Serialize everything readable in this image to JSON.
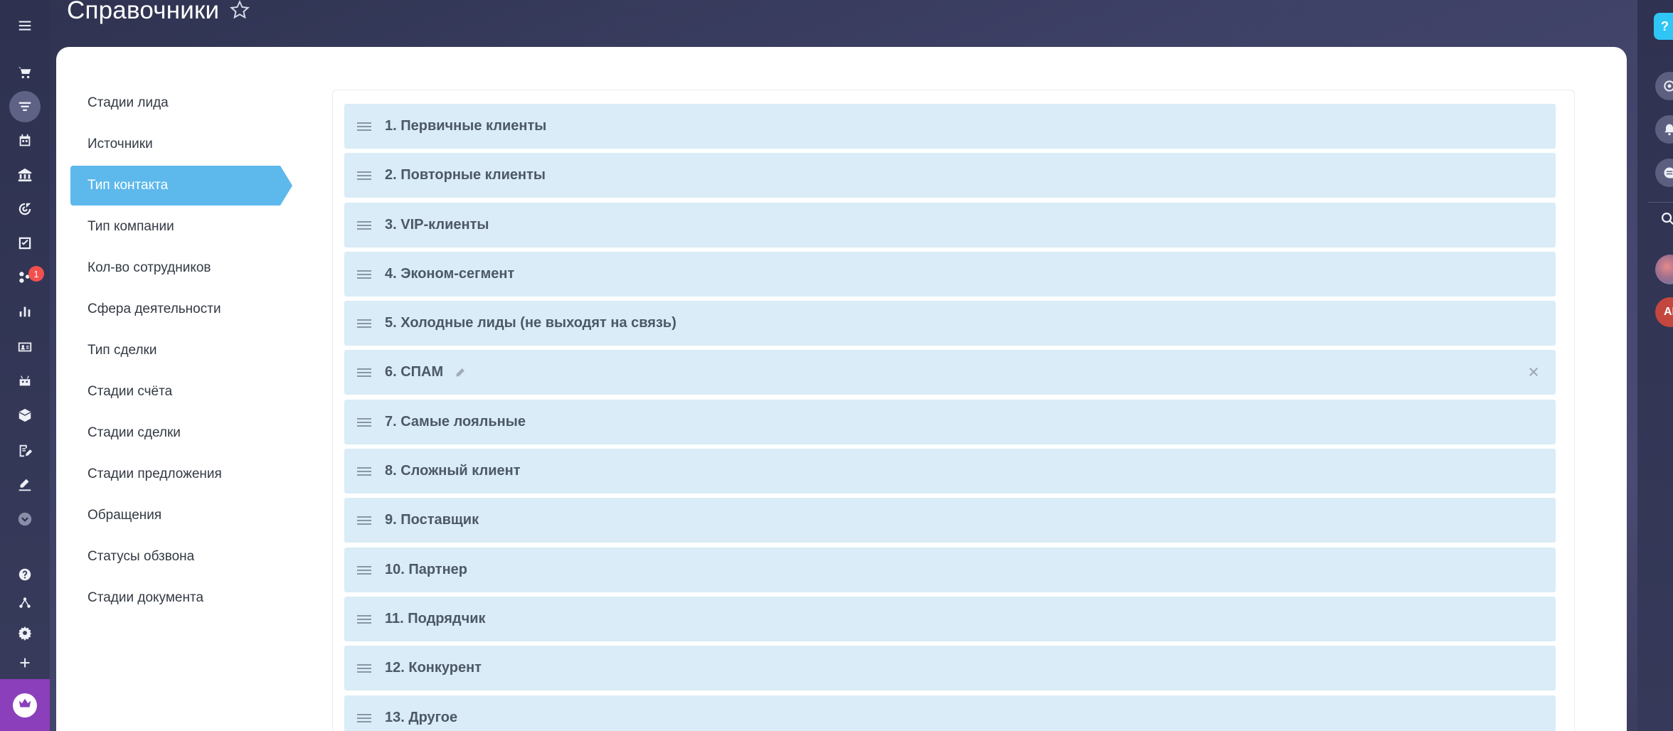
{
  "page": {
    "title": "Справочники"
  },
  "left_bar": {
    "badge_count": "1",
    "icons": [
      "menu-icon",
      "cart-icon",
      "funnel-icon",
      "calendar-icon",
      "bank-icon",
      "target-icon",
      "checkbox-icon",
      "network-icon",
      "chart-icon",
      "contact-card-icon",
      "robot-icon",
      "box-icon",
      "document-edit-icon",
      "signature-icon",
      "chevron-down-icon",
      "help-icon",
      "tree-icon",
      "gear-icon",
      "plus-icon",
      "crown-icon"
    ]
  },
  "menu": {
    "items": [
      {
        "label": "Стадии лида"
      },
      {
        "label": "Источники"
      },
      {
        "label": "Тип контакта"
      },
      {
        "label": "Тип компании"
      },
      {
        "label": "Кол-во сотрудников"
      },
      {
        "label": "Сфера деятельности"
      },
      {
        "label": "Тип сделки"
      },
      {
        "label": "Стадии счёта"
      },
      {
        "label": "Стадии сделки"
      },
      {
        "label": "Стадии предложения"
      },
      {
        "label": "Обращения"
      },
      {
        "label": "Статусы обзвона"
      },
      {
        "label": "Стадии документа"
      }
    ],
    "active_index": 2
  },
  "list": {
    "items": [
      {
        "label": "1. Первичные клиенты"
      },
      {
        "label": "2. Повторные клиенты"
      },
      {
        "label": "3. VIP-клиенты"
      },
      {
        "label": "4. Эконом-сегмент"
      },
      {
        "label": "5. Холодные лиды (не выходят на связь)"
      },
      {
        "label": "6. СПАМ"
      },
      {
        "label": "7. Самые лояльные"
      },
      {
        "label": "8. Сложный клиент"
      },
      {
        "label": "9. Поставщик"
      },
      {
        "label": "10. Партнер"
      },
      {
        "label": "11. Подрядчик"
      },
      {
        "label": "12. Конкурент"
      },
      {
        "label": "13. Другое"
      }
    ],
    "hovered_index": 5
  },
  "right_bar": {
    "help_label": "?",
    "user_initials": "АК"
  },
  "colors": {
    "accent": "#5db8ec",
    "row_bg": "#d9ecf7",
    "badge": "#f1504f",
    "crown_tile": "#8b3fba",
    "help": "#2fc6f6"
  }
}
